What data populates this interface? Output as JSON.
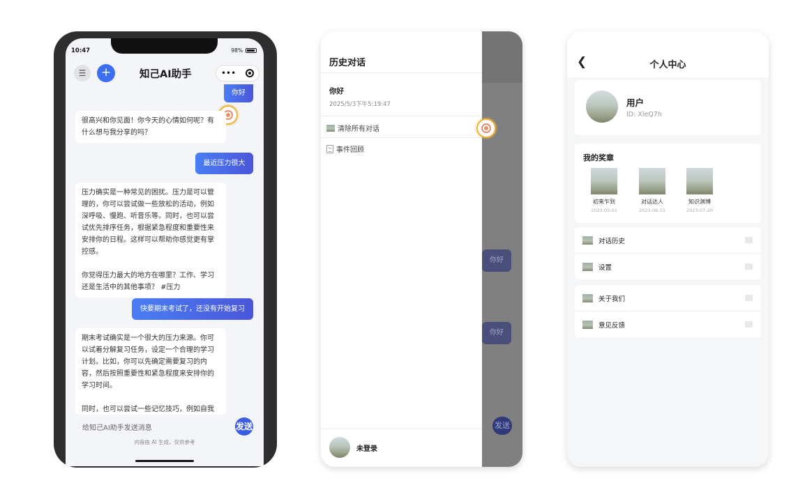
{
  "phone1": {
    "status_time": "10:47",
    "battery": "98%",
    "title": "知己AI助手",
    "menu_icon": "hamburger-icon",
    "plus_label": "+",
    "capsule_more": "•••",
    "messages": [
      {
        "role": "user",
        "text": "你好"
      },
      {
        "role": "ai",
        "text": "很高兴和你见面！你今天的心情如何呢？有什么想与我分享的吗？"
      },
      {
        "role": "user",
        "text": "最近压力很大"
      },
      {
        "role": "ai",
        "text": "压力确实是一种常见的困扰。压力是可以管理的，你可以尝试做一些放松的活动，例如深呼吸、慢跑、听音乐等。同时，也可以尝试优先排序任务，根据紧急程度和重要性来安排你的日程。这样可以帮助你感觉更有掌控感。\n\n你觉得压力最大的地方在哪里？工作、学习还是生活中的其他事项？ #压力"
      },
      {
        "role": "user",
        "text": "快要期末考试了，还没有开始复习"
      },
      {
        "role": "ai",
        "text": "期末考试确实是一个很大的压力来源。你可以试着分解复习任务，设定一个合理的学习计划。比如，你可以先确定需要复习的内容，然后按照重要性和紧急程度来安排你的学习时间。\n\n同时，也可以尝试一些记忆技巧，例如自我做题、脑力激荡等，这些技巧可以帮助你更"
      }
    ],
    "input_placeholder": "给知己AI助手发送消息",
    "send_label": "发送",
    "disclaimer": "内容由 AI 生成，仅供参考"
  },
  "phone2": {
    "title": "历史对话",
    "history": [
      {
        "title": "你好",
        "time": "2025/5/3下午5:19:47"
      }
    ],
    "clear_label": "清除所有对话",
    "review_label": "事件回顾",
    "user_label": "未登录",
    "overlay_bubble_1": "你好",
    "overlay_bubble_2": "你好",
    "overlay_send": "发送"
  },
  "phone3": {
    "title": "个人中心",
    "back_icon": "chevron-left-icon",
    "user_name": "用户",
    "user_id": "ID: XleQ7h",
    "medals_title": "我的奖章",
    "medals": [
      {
        "name": "初来乍到",
        "date": "2023-05-01"
      },
      {
        "name": "对话达人",
        "date": "2023-06-15"
      },
      {
        "name": "知识渊博",
        "date": "2023-07-20"
      }
    ],
    "menu_group_1": [
      {
        "label": "对话历史"
      },
      {
        "label": "设置"
      }
    ],
    "menu_group_2": [
      {
        "label": "关于我们"
      },
      {
        "label": "意见反馈"
      }
    ]
  },
  "colors": {
    "accent": "#3b6ef0",
    "user_bubble_start": "#4a7ef5",
    "user_bubble_end": "#4b56d8",
    "badge_ring": "#f0b33a"
  }
}
